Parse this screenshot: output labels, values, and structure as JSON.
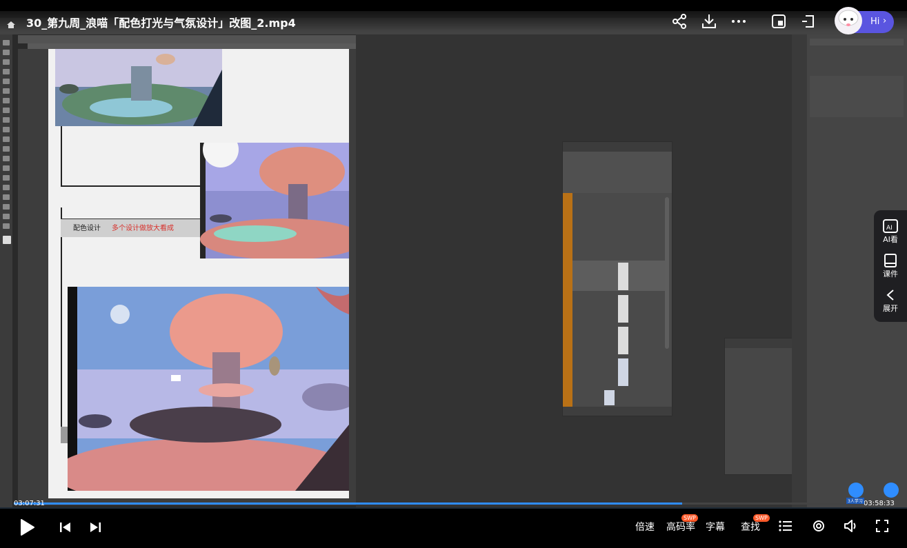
{
  "video": {
    "title": "30_第九周_浪喵「配色打光与气氛设计」改图_2.mp4",
    "current_time": "03:07:31",
    "total_time": "03:58:33",
    "progress": 0.76
  },
  "top_actions": {
    "share_icon": "share-icon",
    "download_icon": "download-icon",
    "more_icon": "more-icon",
    "pip_icon": "picture-in-picture-icon",
    "window_icon": "float-window-icon",
    "assistant_label": "Hi"
  },
  "side_panel": {
    "ai_label": "AI看",
    "courseware_label": "课件",
    "expand_label": "展开"
  },
  "canvas": {
    "annotation_heading": "配色设计",
    "annotation_note": "多个设计做放大看成"
  },
  "bottom_controls": {
    "speed_label": "倍速",
    "bitrate_label": "高码率",
    "subtitle_label": "字幕",
    "search_label": "查找",
    "swp_badge": "SWP",
    "viewers_label": "3人学习"
  },
  "colors": {
    "accent": "#2f8dff",
    "assistant": "#5a55e0",
    "layer_orange": "#b97116",
    "annotation_red": "#d8312c"
  }
}
